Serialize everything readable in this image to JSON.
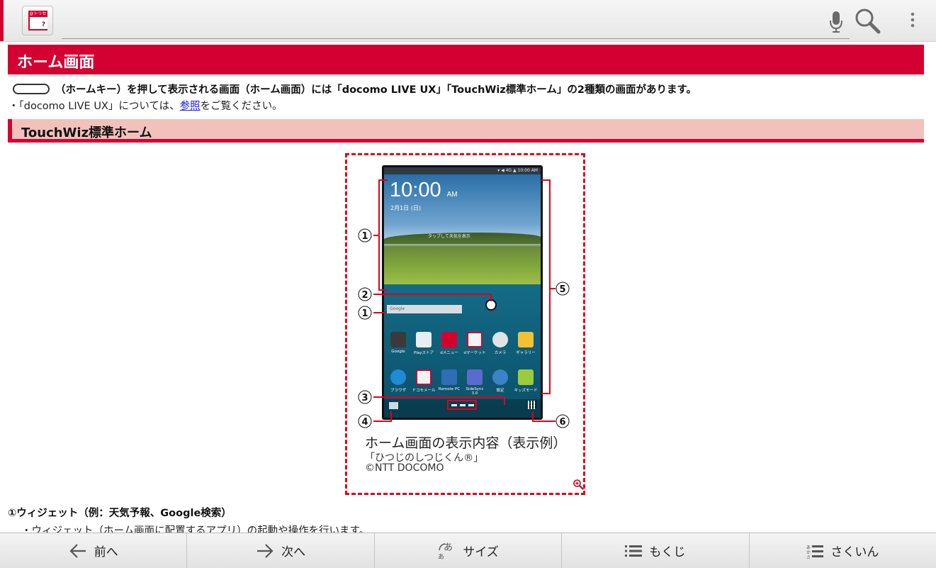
{
  "toolbar": {
    "app_icon_tag": "@トリセツ",
    "app_icon_mark": "?",
    "url_value": ""
  },
  "page": {
    "title": "ホーム画面",
    "intro": "（ホームキー）を押して表示される画面（ホーム画面）には「docomo LIVE UX」「TouchWiz標準ホーム」の2種類の画面があります。",
    "note_prefix": "・「docomo LIVE UX」については、",
    "note_link": "参照",
    "note_suffix": "をご覧ください。",
    "subheading": "TouchWiz標準ホーム"
  },
  "figure": {
    "clock": "10:00",
    "clock_ampm": "AM",
    "date": "2月1日 (日)",
    "weather_hint": "タップして天気を表示",
    "status_text": "▾ ◀ 4G ▲ 10:00 AM",
    "search_bar": "Google",
    "apps_row1": [
      "Google",
      "Playストア",
      "dメニュー",
      "dマーケット",
      "カメラ",
      "ギャラリー"
    ],
    "apps_row2": [
      "ブラウザ",
      "ドコモメール",
      "Remote PC",
      "SideSync 3.0",
      "設定",
      "キッズモード"
    ],
    "callout_numbers": [
      "①",
      "②",
      "①",
      "③",
      "④",
      "⑤",
      "⑥"
    ],
    "caption": "ホーム画面の表示内容（表示例）",
    "caption_sub1": "「ひつじのしつじくん®」",
    "caption_sub2": "©NTT DOCOMO"
  },
  "items": {
    "item1_title": "①ウィジェット（例：天気予報、Google検索）",
    "item1_desc": "・ウィジェット（ホーム画面に配置するアプリ）の起動や操作を行います。"
  },
  "bottom_nav": {
    "prev": "前へ",
    "next": "次へ",
    "size": "サイズ",
    "toc": "もくじ",
    "index": "さくいん"
  },
  "colors": {
    "accent_red": "#d50032",
    "subheading_bg": "#f2c1bc",
    "link_blue": "#1a1aff"
  }
}
